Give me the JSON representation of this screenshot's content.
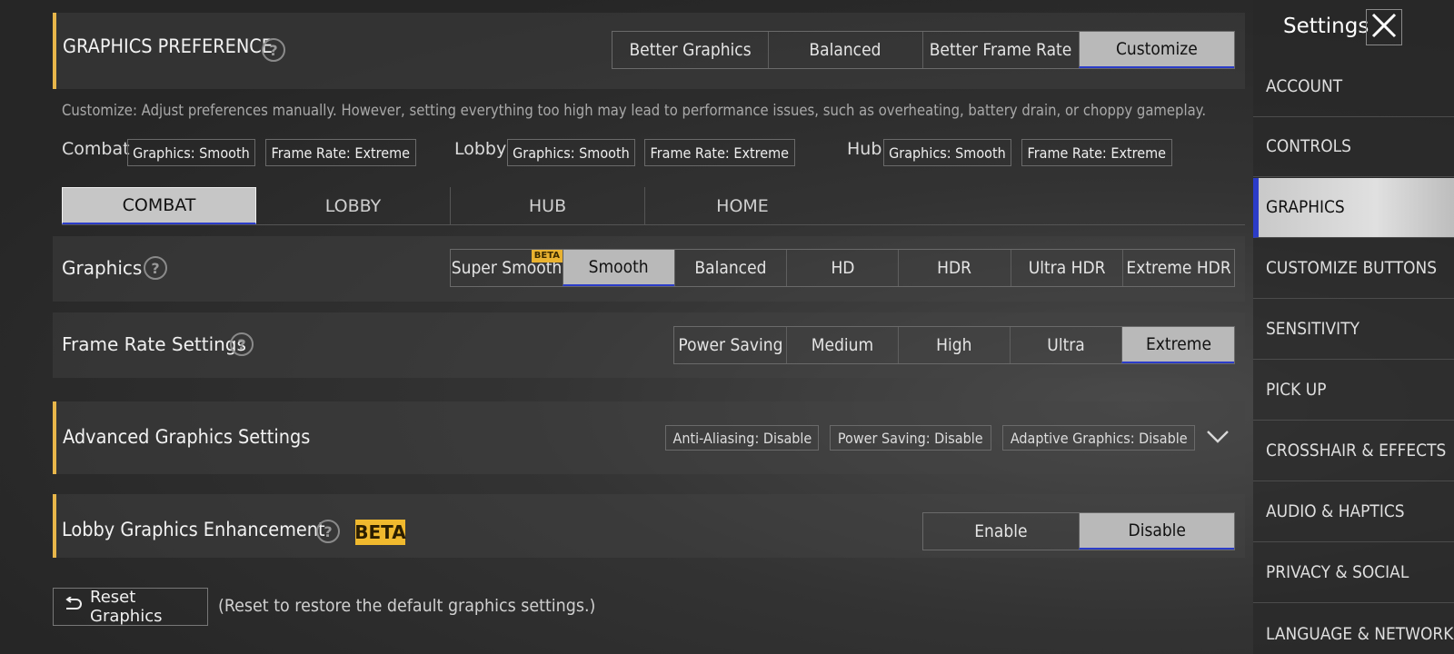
{
  "graphics_preference": {
    "title": "GRAPHICS PREFERENCE",
    "options": [
      "Better Graphics",
      "Balanced",
      "Better Frame Rate",
      "Customize"
    ],
    "selected": "Customize",
    "description": "Customize: Adjust preferences manually. However, setting everything too high may lead to performance issues, such as overheating, battery drain, or choppy gameplay.",
    "summary": [
      {
        "scene": "Combat",
        "graphics": "Graphics: Smooth",
        "frame_rate": "Frame Rate: Extreme"
      },
      {
        "scene": "Lobby",
        "graphics": "Graphics: Smooth",
        "frame_rate": "Frame Rate: Extreme"
      },
      {
        "scene": "Hub",
        "graphics": "Graphics: Smooth",
        "frame_rate": "Frame Rate: Extreme"
      }
    ]
  },
  "scene_tabs": [
    "COMBAT",
    "LOBBY",
    "HUB",
    "HOME"
  ],
  "selected_scene_tab": "COMBAT",
  "graphics": {
    "label": "Graphics",
    "options": [
      "Super Smooth",
      "Smooth",
      "Balanced",
      "HD",
      "HDR",
      "Ultra HDR",
      "Extreme HDR"
    ],
    "selected": "Smooth",
    "beta_tag": "BETA"
  },
  "frame_rate": {
    "label": "Frame Rate Settings",
    "options": [
      "Power Saving",
      "Medium",
      "High",
      "Ultra",
      "Extreme"
    ],
    "selected": "Extreme"
  },
  "advanced": {
    "title": "Advanced Graphics Settings",
    "chips": [
      "Anti-Aliasing: Disable",
      "Power Saving: Disable",
      "Adaptive Graphics: Disable"
    ],
    "expand_icon": "chevron-down-icon"
  },
  "lobby_enhancement": {
    "title": "Lobby Graphics Enhancement",
    "beta": "BETA",
    "options": [
      "Enable",
      "Disable"
    ],
    "selected": "Disable"
  },
  "reset": {
    "label": "Reset Graphics",
    "note": "(Reset to restore the default graphics settings.)",
    "icon": "reset-icon"
  },
  "sidebar": {
    "title": "Settings",
    "items": [
      "ACCOUNT",
      "CONTROLS",
      "GRAPHICS",
      "CUSTOMIZE BUTTONS",
      "SENSITIVITY",
      "PICK UP",
      "CROSSHAIR & EFFECTS",
      "AUDIO & HAPTICS",
      "PRIVACY & SOCIAL",
      "LANGUAGE & NETWORK"
    ],
    "selected": "GRAPHICS"
  },
  "colors": {
    "accent": "#e8b64a",
    "selected_bg": "#b9b9b9",
    "selected_underline": "#2b3cc8",
    "beta": "#f0b92e"
  }
}
